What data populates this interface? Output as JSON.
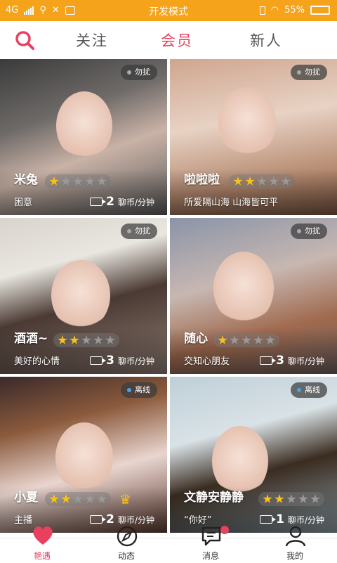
{
  "status_bar": {
    "network": "4G",
    "title": "开发模式",
    "battery": "55%"
  },
  "top_nav": {
    "tabs": [
      {
        "label": "关注"
      },
      {
        "label": "会员"
      },
      {
        "label": "新人"
      }
    ],
    "active_tab": "会员"
  },
  "colors": {
    "accent": "#e84160",
    "status_bar": "#f5a31a",
    "star_on": "#f6c21b",
    "star_off": "#9a9a9a",
    "offline_dot": "#4aa3e8"
  },
  "cards": [
    {
      "name": "米兔",
      "status": "勿扰",
      "stars": 1,
      "signature": "困意",
      "price": "2",
      "unit": "聊币/分钟"
    },
    {
      "name": "啦啦啦",
      "status": "勿扰",
      "stars": 2,
      "signature": "所爱隔山海 山海皆可平",
      "price": "",
      "unit": ""
    },
    {
      "name": "酒酒~",
      "status": "勿扰",
      "stars": 2,
      "signature": "美好的心情",
      "price": "3",
      "unit": "聊币/分钟"
    },
    {
      "name": "随心",
      "status": "勿扰",
      "stars": 1,
      "signature": "交知心朋友",
      "price": "3",
      "unit": "聊币/分钟"
    },
    {
      "name": "小夏",
      "status": "离线",
      "stars": 2,
      "signature": "主播",
      "price": "2",
      "unit": "聊币/分钟",
      "crown": "♛"
    },
    {
      "name": "文静安静静",
      "status": "离线",
      "stars": 2,
      "signature": "“你好”",
      "price": "1",
      "unit": "聊币/分钟"
    }
  ],
  "bottom_nav": {
    "items": [
      {
        "label": "艳遇",
        "icon": "heart-icon"
      },
      {
        "label": "动态",
        "icon": "compass-icon"
      },
      {
        "label": "消息",
        "icon": "chat-icon"
      },
      {
        "label": "我的",
        "icon": "person-icon"
      }
    ],
    "active": "艳遇"
  }
}
